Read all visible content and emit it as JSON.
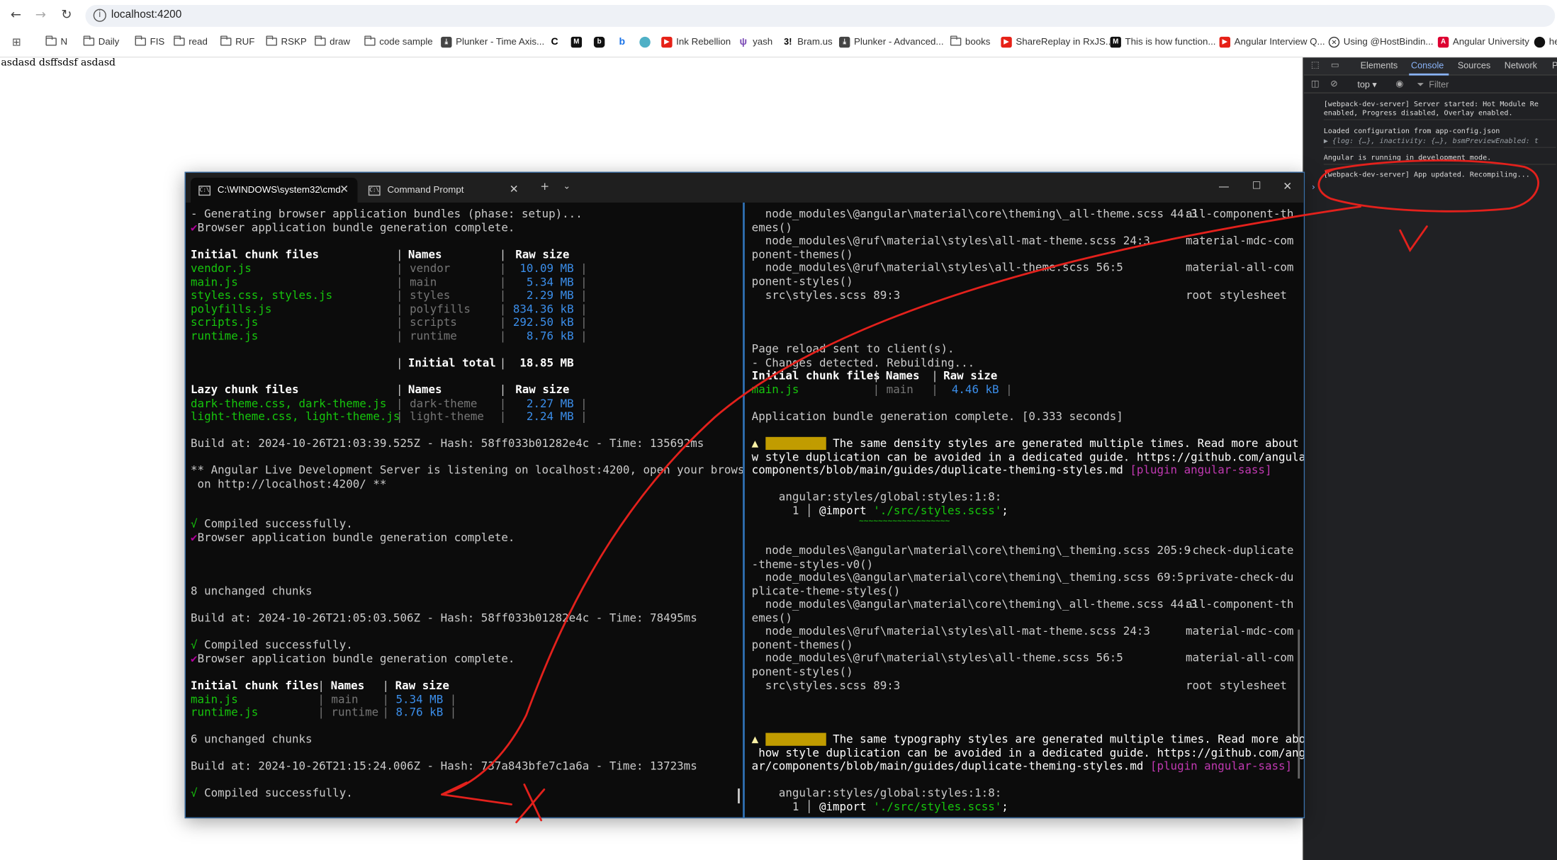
{
  "browser": {
    "url": "localhost:4200",
    "bookmarks": [
      "N",
      "Daily",
      "FIS",
      "read",
      "RUF",
      "RSKP",
      "draw",
      "code sample",
      "Plunker - Time Axis...",
      "",
      "",
      "",
      "",
      "",
      "Ink Rebellion",
      "yash",
      "Bram.us",
      "Plunker - Advanced...",
      "books",
      "ShareReplay in RxJS...",
      "This is how function...",
      "Angular Interview Q...",
      "Using @HostBindin...",
      "Angular University",
      "he"
    ],
    "page_text": "asdasd dsffsdsf asdasd"
  },
  "devtools": {
    "tabs": [
      "Elements",
      "Console",
      "Sources",
      "Network",
      "P"
    ],
    "context": "top",
    "filter_placeholder": "Filter",
    "logs": [
      "[webpack-dev-server] Server started: Hot Module Re\nenabled, Progress disabled, Overlay enabled.",
      "Loaded configuration from app-config.json",
      "▶ {log: {…}, inactivity: {…}, bsmPreviewEnabled: t",
      "Angular is running in development mode.",
      "[webpack-dev-server] App updated. Recompiling..."
    ],
    "prompt": "›"
  },
  "terminal": {
    "tabs": [
      "C:\\WINDOWS\\system32\\cmd.",
      "Command Prompt"
    ],
    "left_pane": {
      "l1": "- Generating browser application bundles (phase: setup)...",
      "l2": "Browser application bundle generation complete.",
      "check": "✔",
      "h1_files": "Initial chunk files",
      "h1_names": "Names",
      "h1_size": "Raw size",
      "sep": "|",
      "initial_rows": [
        {
          "file": "vendor.js",
          "name": "vendor",
          "size": "10.09 MB"
        },
        {
          "file": "main.js",
          "name": "main",
          "size": "5.34 MB"
        },
        {
          "file": "styles.css, styles.js",
          "name": "styles",
          "size": "2.29 MB"
        },
        {
          "file": "polyfills.js",
          "name": "polyfills",
          "size": "834.36 kB"
        },
        {
          "file": "scripts.js",
          "name": "scripts",
          "size": "292.50 kB"
        },
        {
          "file": "runtime.js",
          "name": "runtime",
          "size": "8.76 kB"
        }
      ],
      "initial_total_label": "Initial total",
      "initial_total": "18.85 MB",
      "h2_files": "Lazy chunk files",
      "lazy_rows": [
        {
          "file": "dark-theme.css, dark-theme.js",
          "name": "dark-theme",
          "size": "2.27 MB"
        },
        {
          "file": "light-theme.css, light-theme.js",
          "name": "light-theme",
          "size": "2.24 MB"
        }
      ],
      "build1": "Build at: 2024-10-26T21:03:39.525Z - Hash: 58ff033b01282e4c - Time: 135692ms",
      "listen1": "** Angular Live Development Server is listening on localhost:4200, open your browser",
      "listen2": " on http://localhost:4200/ **",
      "compiled": "Compiled successfully.",
      "tick": "√",
      "unchanged8": "8 unchanged chunks",
      "build2": "Build at: 2024-10-26T21:05:03.506Z - Hash: 58ff033b01282e4c - Time: 78495ms",
      "small_rows": [
        {
          "file": "main.js",
          "name": "main",
          "size": "5.34 MB"
        },
        {
          "file": "runtime.js",
          "name": "runtime",
          "size": "8.76 kB"
        }
      ],
      "unchanged6": "6 unchanged chunks",
      "build3": "Build at: 2024-10-26T21:15:24.006Z - Hash: 737a843bfe7c1a6a - Time: 13723ms"
    },
    "right_pane": {
      "r1a": "  node_modules\\@angular\\material\\core\\theming\\_all-theme.scss 44:3",
      "r1b": "all-component-th",
      "r1c": "emes()",
      "r2a": "  node_modules\\@ruf\\material\\styles\\all-mat-theme.scss 24:3",
      "r2b": "material-mdc-com",
      "r2c": "ponent-themes()",
      "r3a": "  node_modules\\@ruf\\material\\styles\\all-theme.scss 56:5",
      "r3b": "material-all-com",
      "r3c": "ponent-styles()",
      "r4a": "  src\\styles.scss 89:3",
      "r4b": "root stylesheet",
      "reload": "Page reload sent to client(s).",
      "changes": "- Changes detected. Rebuilding...",
      "h_files": "Initial chunk files",
      "h_names": "Names",
      "h_size": "Raw size",
      "main_file": "main.js",
      "main_name": "main",
      "main_size": "4.46 kB",
      "bundle": "Application bundle generation complete. [0.333 seconds]",
      "warn_marker": "▲",
      "warn_label": "[WARNING]",
      "w1a": " The same density styles are generated multiple times. Read more about ho",
      "w1b": "w style duplication can be avoided in a dedicated guide. https://github.com/angular/",
      "w1c": "components/blob/main/guides/duplicate-theming-styles.md",
      "plugin": "[plugin angular-sass]",
      "loc": "    angular:styles/global:styles:1:8:",
      "import_line_no": "      1 │ ",
      "import_kw": "@import ",
      "import_str": "'./src/styles.scss'",
      "import_end": ";",
      "squiggle": "~~~~~~~~~~~~~~~~~~~",
      "t1a": "  node_modules\\@angular\\material\\core\\theming\\_theming.scss 205:9",
      "t1b": "-check-duplicate",
      "t1c": "-theme-styles-v0()",
      "t2a": "  node_modules\\@angular\\material\\core\\theming\\_theming.scss 69:5",
      "t2b": "private-check-du",
      "t2c": "plicate-theme-styles()",
      "w2a": " The same typography styles are generated multiple times. Read more about",
      "w2b": " how style duplication can be avoided in a dedicated guide. https://github.com/angul",
      "w2c": "ar/components/blob/main/guides/duplicate-theming-styles.md"
    }
  }
}
